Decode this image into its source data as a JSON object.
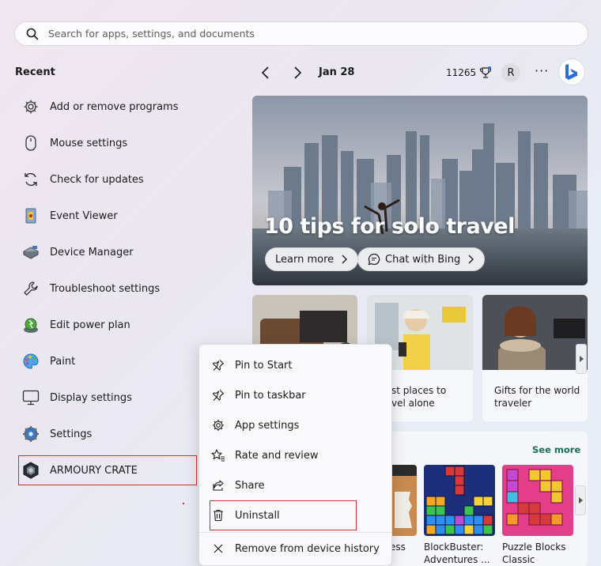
{
  "search": {
    "placeholder": "Search for apps, settings, and documents"
  },
  "recent": {
    "title": "Recent",
    "items": [
      {
        "label": "Add or remove programs",
        "icon": "gear-icon"
      },
      {
        "label": "Mouse settings",
        "icon": "mouse-icon"
      },
      {
        "label": "Check for updates",
        "icon": "refresh-icon"
      },
      {
        "label": "Event Viewer",
        "icon": "event-viewer-icon"
      },
      {
        "label": "Device Manager",
        "icon": "device-manager-icon"
      },
      {
        "label": "Troubleshoot settings",
        "icon": "wrench-icon"
      },
      {
        "label": "Edit power plan",
        "icon": "power-plan-icon"
      },
      {
        "label": "Paint",
        "icon": "paint-palette-icon"
      },
      {
        "label": "Display settings",
        "icon": "monitor-icon"
      },
      {
        "label": "Settings",
        "icon": "settings-gear-icon"
      },
      {
        "label": "ARMOURY CRATE",
        "icon": "armoury-crate-icon"
      }
    ]
  },
  "topbar": {
    "date": "Jan 28",
    "points": "11265",
    "avatar": "R",
    "more": "···"
  },
  "hero": {
    "title": "10 tips for solo travel",
    "learn_more": "Learn more",
    "chat_with_bing": "Chat with Bing"
  },
  "cards": [
    {
      "caption": ""
    },
    {
      "caption": "st places to\nvel alone"
    },
    {
      "caption": "Gifts for the world\ntraveler"
    }
  ],
  "games": {
    "see_more": "See more",
    "tiles": [
      {
        "name": "ess"
      },
      {
        "name": "BlockBuster:\nAdventures ..."
      },
      {
        "name": "Puzzle Blocks\nClassic"
      }
    ]
  },
  "context_menu": {
    "items": [
      {
        "label": "Pin to Start",
        "icon": "pin-icon"
      },
      {
        "label": "Pin to taskbar",
        "icon": "pin-icon"
      },
      {
        "label": "App settings",
        "icon": "gear-icon"
      },
      {
        "label": "Rate and review",
        "icon": "star-icon"
      },
      {
        "label": "Share",
        "icon": "share-icon"
      },
      {
        "label": "Uninstall",
        "icon": "trash-icon"
      },
      {
        "label": "Remove from device history",
        "icon": "close-icon"
      }
    ]
  },
  "colors": {
    "highlight": "#d0312d",
    "accent": "#1a6b5a",
    "bing_blue": "#2b6fd6"
  }
}
